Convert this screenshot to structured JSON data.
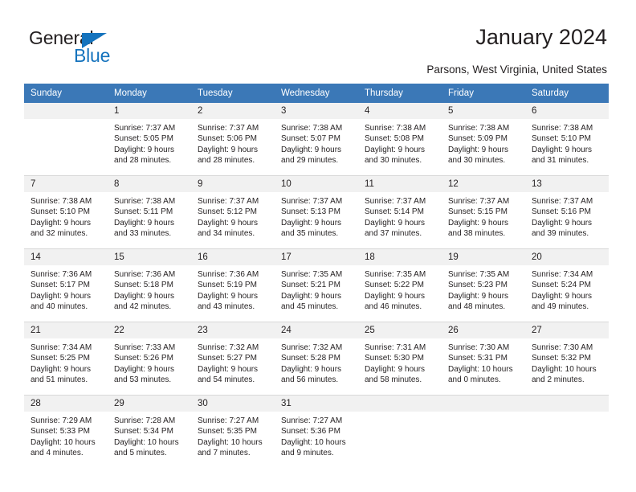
{
  "logo": {
    "word1": "General",
    "word2": "Blue",
    "triangle_color": "#1573bd",
    "text_color": "#231f20"
  },
  "header": {
    "title": "January 2024",
    "subtitle": "Parsons, West Virginia, United States"
  },
  "theme": {
    "header_bg": "#3b78b7",
    "header_text": "#ffffff",
    "daynum_bg": "#f1f1f1",
    "cell_bg": "#ffffff",
    "grid_line": "#d8d8d8"
  },
  "weekdays": [
    "Sunday",
    "Monday",
    "Tuesday",
    "Wednesday",
    "Thursday",
    "Friday",
    "Saturday"
  ],
  "labels": {
    "sunrise_prefix": "Sunrise:",
    "sunset_prefix": "Sunset:",
    "daylight_prefix": "Daylight:"
  },
  "weeks": [
    [
      {
        "day": "",
        "sunrise": "",
        "sunset": "",
        "daylight_line1": "",
        "daylight_line2": "",
        "blank": true
      },
      {
        "day": "1",
        "sunrise": "Sunrise: 7:37 AM",
        "sunset": "Sunset: 5:05 PM",
        "daylight_line1": "Daylight: 9 hours",
        "daylight_line2": "and 28 minutes."
      },
      {
        "day": "2",
        "sunrise": "Sunrise: 7:37 AM",
        "sunset": "Sunset: 5:06 PM",
        "daylight_line1": "Daylight: 9 hours",
        "daylight_line2": "and 28 minutes."
      },
      {
        "day": "3",
        "sunrise": "Sunrise: 7:38 AM",
        "sunset": "Sunset: 5:07 PM",
        "daylight_line1": "Daylight: 9 hours",
        "daylight_line2": "and 29 minutes."
      },
      {
        "day": "4",
        "sunrise": "Sunrise: 7:38 AM",
        "sunset": "Sunset: 5:08 PM",
        "daylight_line1": "Daylight: 9 hours",
        "daylight_line2": "and 30 minutes."
      },
      {
        "day": "5",
        "sunrise": "Sunrise: 7:38 AM",
        "sunset": "Sunset: 5:09 PM",
        "daylight_line1": "Daylight: 9 hours",
        "daylight_line2": "and 30 minutes."
      },
      {
        "day": "6",
        "sunrise": "Sunrise: 7:38 AM",
        "sunset": "Sunset: 5:10 PM",
        "daylight_line1": "Daylight: 9 hours",
        "daylight_line2": "and 31 minutes."
      }
    ],
    [
      {
        "day": "7",
        "sunrise": "Sunrise: 7:38 AM",
        "sunset": "Sunset: 5:10 PM",
        "daylight_line1": "Daylight: 9 hours",
        "daylight_line2": "and 32 minutes."
      },
      {
        "day": "8",
        "sunrise": "Sunrise: 7:38 AM",
        "sunset": "Sunset: 5:11 PM",
        "daylight_line1": "Daylight: 9 hours",
        "daylight_line2": "and 33 minutes."
      },
      {
        "day": "9",
        "sunrise": "Sunrise: 7:37 AM",
        "sunset": "Sunset: 5:12 PM",
        "daylight_line1": "Daylight: 9 hours",
        "daylight_line2": "and 34 minutes."
      },
      {
        "day": "10",
        "sunrise": "Sunrise: 7:37 AM",
        "sunset": "Sunset: 5:13 PM",
        "daylight_line1": "Daylight: 9 hours",
        "daylight_line2": "and 35 minutes."
      },
      {
        "day": "11",
        "sunrise": "Sunrise: 7:37 AM",
        "sunset": "Sunset: 5:14 PM",
        "daylight_line1": "Daylight: 9 hours",
        "daylight_line2": "and 37 minutes."
      },
      {
        "day": "12",
        "sunrise": "Sunrise: 7:37 AM",
        "sunset": "Sunset: 5:15 PM",
        "daylight_line1": "Daylight: 9 hours",
        "daylight_line2": "and 38 minutes."
      },
      {
        "day": "13",
        "sunrise": "Sunrise: 7:37 AM",
        "sunset": "Sunset: 5:16 PM",
        "daylight_line1": "Daylight: 9 hours",
        "daylight_line2": "and 39 minutes."
      }
    ],
    [
      {
        "day": "14",
        "sunrise": "Sunrise: 7:36 AM",
        "sunset": "Sunset: 5:17 PM",
        "daylight_line1": "Daylight: 9 hours",
        "daylight_line2": "and 40 minutes."
      },
      {
        "day": "15",
        "sunrise": "Sunrise: 7:36 AM",
        "sunset": "Sunset: 5:18 PM",
        "daylight_line1": "Daylight: 9 hours",
        "daylight_line2": "and 42 minutes."
      },
      {
        "day": "16",
        "sunrise": "Sunrise: 7:36 AM",
        "sunset": "Sunset: 5:19 PM",
        "daylight_line1": "Daylight: 9 hours",
        "daylight_line2": "and 43 minutes."
      },
      {
        "day": "17",
        "sunrise": "Sunrise: 7:35 AM",
        "sunset": "Sunset: 5:21 PM",
        "daylight_line1": "Daylight: 9 hours",
        "daylight_line2": "and 45 minutes."
      },
      {
        "day": "18",
        "sunrise": "Sunrise: 7:35 AM",
        "sunset": "Sunset: 5:22 PM",
        "daylight_line1": "Daylight: 9 hours",
        "daylight_line2": "and 46 minutes."
      },
      {
        "day": "19",
        "sunrise": "Sunrise: 7:35 AM",
        "sunset": "Sunset: 5:23 PM",
        "daylight_line1": "Daylight: 9 hours",
        "daylight_line2": "and 48 minutes."
      },
      {
        "day": "20",
        "sunrise": "Sunrise: 7:34 AM",
        "sunset": "Sunset: 5:24 PM",
        "daylight_line1": "Daylight: 9 hours",
        "daylight_line2": "and 49 minutes."
      }
    ],
    [
      {
        "day": "21",
        "sunrise": "Sunrise: 7:34 AM",
        "sunset": "Sunset: 5:25 PM",
        "daylight_line1": "Daylight: 9 hours",
        "daylight_line2": "and 51 minutes."
      },
      {
        "day": "22",
        "sunrise": "Sunrise: 7:33 AM",
        "sunset": "Sunset: 5:26 PM",
        "daylight_line1": "Daylight: 9 hours",
        "daylight_line2": "and 53 minutes."
      },
      {
        "day": "23",
        "sunrise": "Sunrise: 7:32 AM",
        "sunset": "Sunset: 5:27 PM",
        "daylight_line1": "Daylight: 9 hours",
        "daylight_line2": "and 54 minutes."
      },
      {
        "day": "24",
        "sunrise": "Sunrise: 7:32 AM",
        "sunset": "Sunset: 5:28 PM",
        "daylight_line1": "Daylight: 9 hours",
        "daylight_line2": "and 56 minutes."
      },
      {
        "day": "25",
        "sunrise": "Sunrise: 7:31 AM",
        "sunset": "Sunset: 5:30 PM",
        "daylight_line1": "Daylight: 9 hours",
        "daylight_line2": "and 58 minutes."
      },
      {
        "day": "26",
        "sunrise": "Sunrise: 7:30 AM",
        "sunset": "Sunset: 5:31 PM",
        "daylight_line1": "Daylight: 10 hours",
        "daylight_line2": "and 0 minutes."
      },
      {
        "day": "27",
        "sunrise": "Sunrise: 7:30 AM",
        "sunset": "Sunset: 5:32 PM",
        "daylight_line1": "Daylight: 10 hours",
        "daylight_line2": "and 2 minutes."
      }
    ],
    [
      {
        "day": "28",
        "sunrise": "Sunrise: 7:29 AM",
        "sunset": "Sunset: 5:33 PM",
        "daylight_line1": "Daylight: 10 hours",
        "daylight_line2": "and 4 minutes."
      },
      {
        "day": "29",
        "sunrise": "Sunrise: 7:28 AM",
        "sunset": "Sunset: 5:34 PM",
        "daylight_line1": "Daylight: 10 hours",
        "daylight_line2": "and 5 minutes."
      },
      {
        "day": "30",
        "sunrise": "Sunrise: 7:27 AM",
        "sunset": "Sunset: 5:35 PM",
        "daylight_line1": "Daylight: 10 hours",
        "daylight_line2": "and 7 minutes."
      },
      {
        "day": "31",
        "sunrise": "Sunrise: 7:27 AM",
        "sunset": "Sunset: 5:36 PM",
        "daylight_line1": "Daylight: 10 hours",
        "daylight_line2": "and 9 minutes."
      },
      {
        "day": "",
        "sunrise": "",
        "sunset": "",
        "daylight_line1": "",
        "daylight_line2": "",
        "blank": true,
        "trailing": true
      },
      {
        "day": "",
        "sunrise": "",
        "sunset": "",
        "daylight_line1": "",
        "daylight_line2": "",
        "blank": true,
        "trailing": true
      },
      {
        "day": "",
        "sunrise": "",
        "sunset": "",
        "daylight_line1": "",
        "daylight_line2": "",
        "blank": true,
        "trailing": true
      }
    ]
  ]
}
